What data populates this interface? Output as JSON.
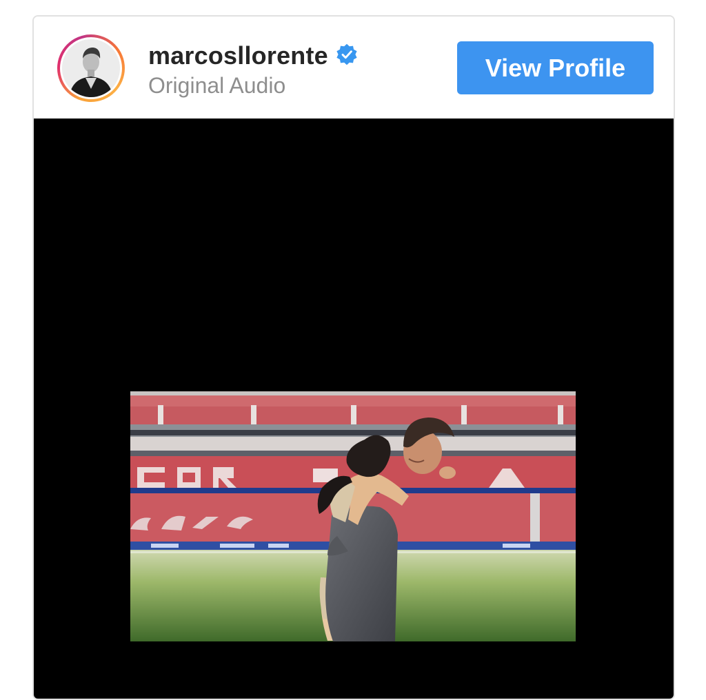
{
  "post": {
    "username": "marcosllorente",
    "subtitle": "Original Audio",
    "verified": true,
    "view_profile_label": "View Profile"
  },
  "colors": {
    "button": "#3d94f0",
    "verified_badge": "#3897f0",
    "video_background": "#000000"
  },
  "icons": {
    "verified": "verified-badge-icon"
  }
}
